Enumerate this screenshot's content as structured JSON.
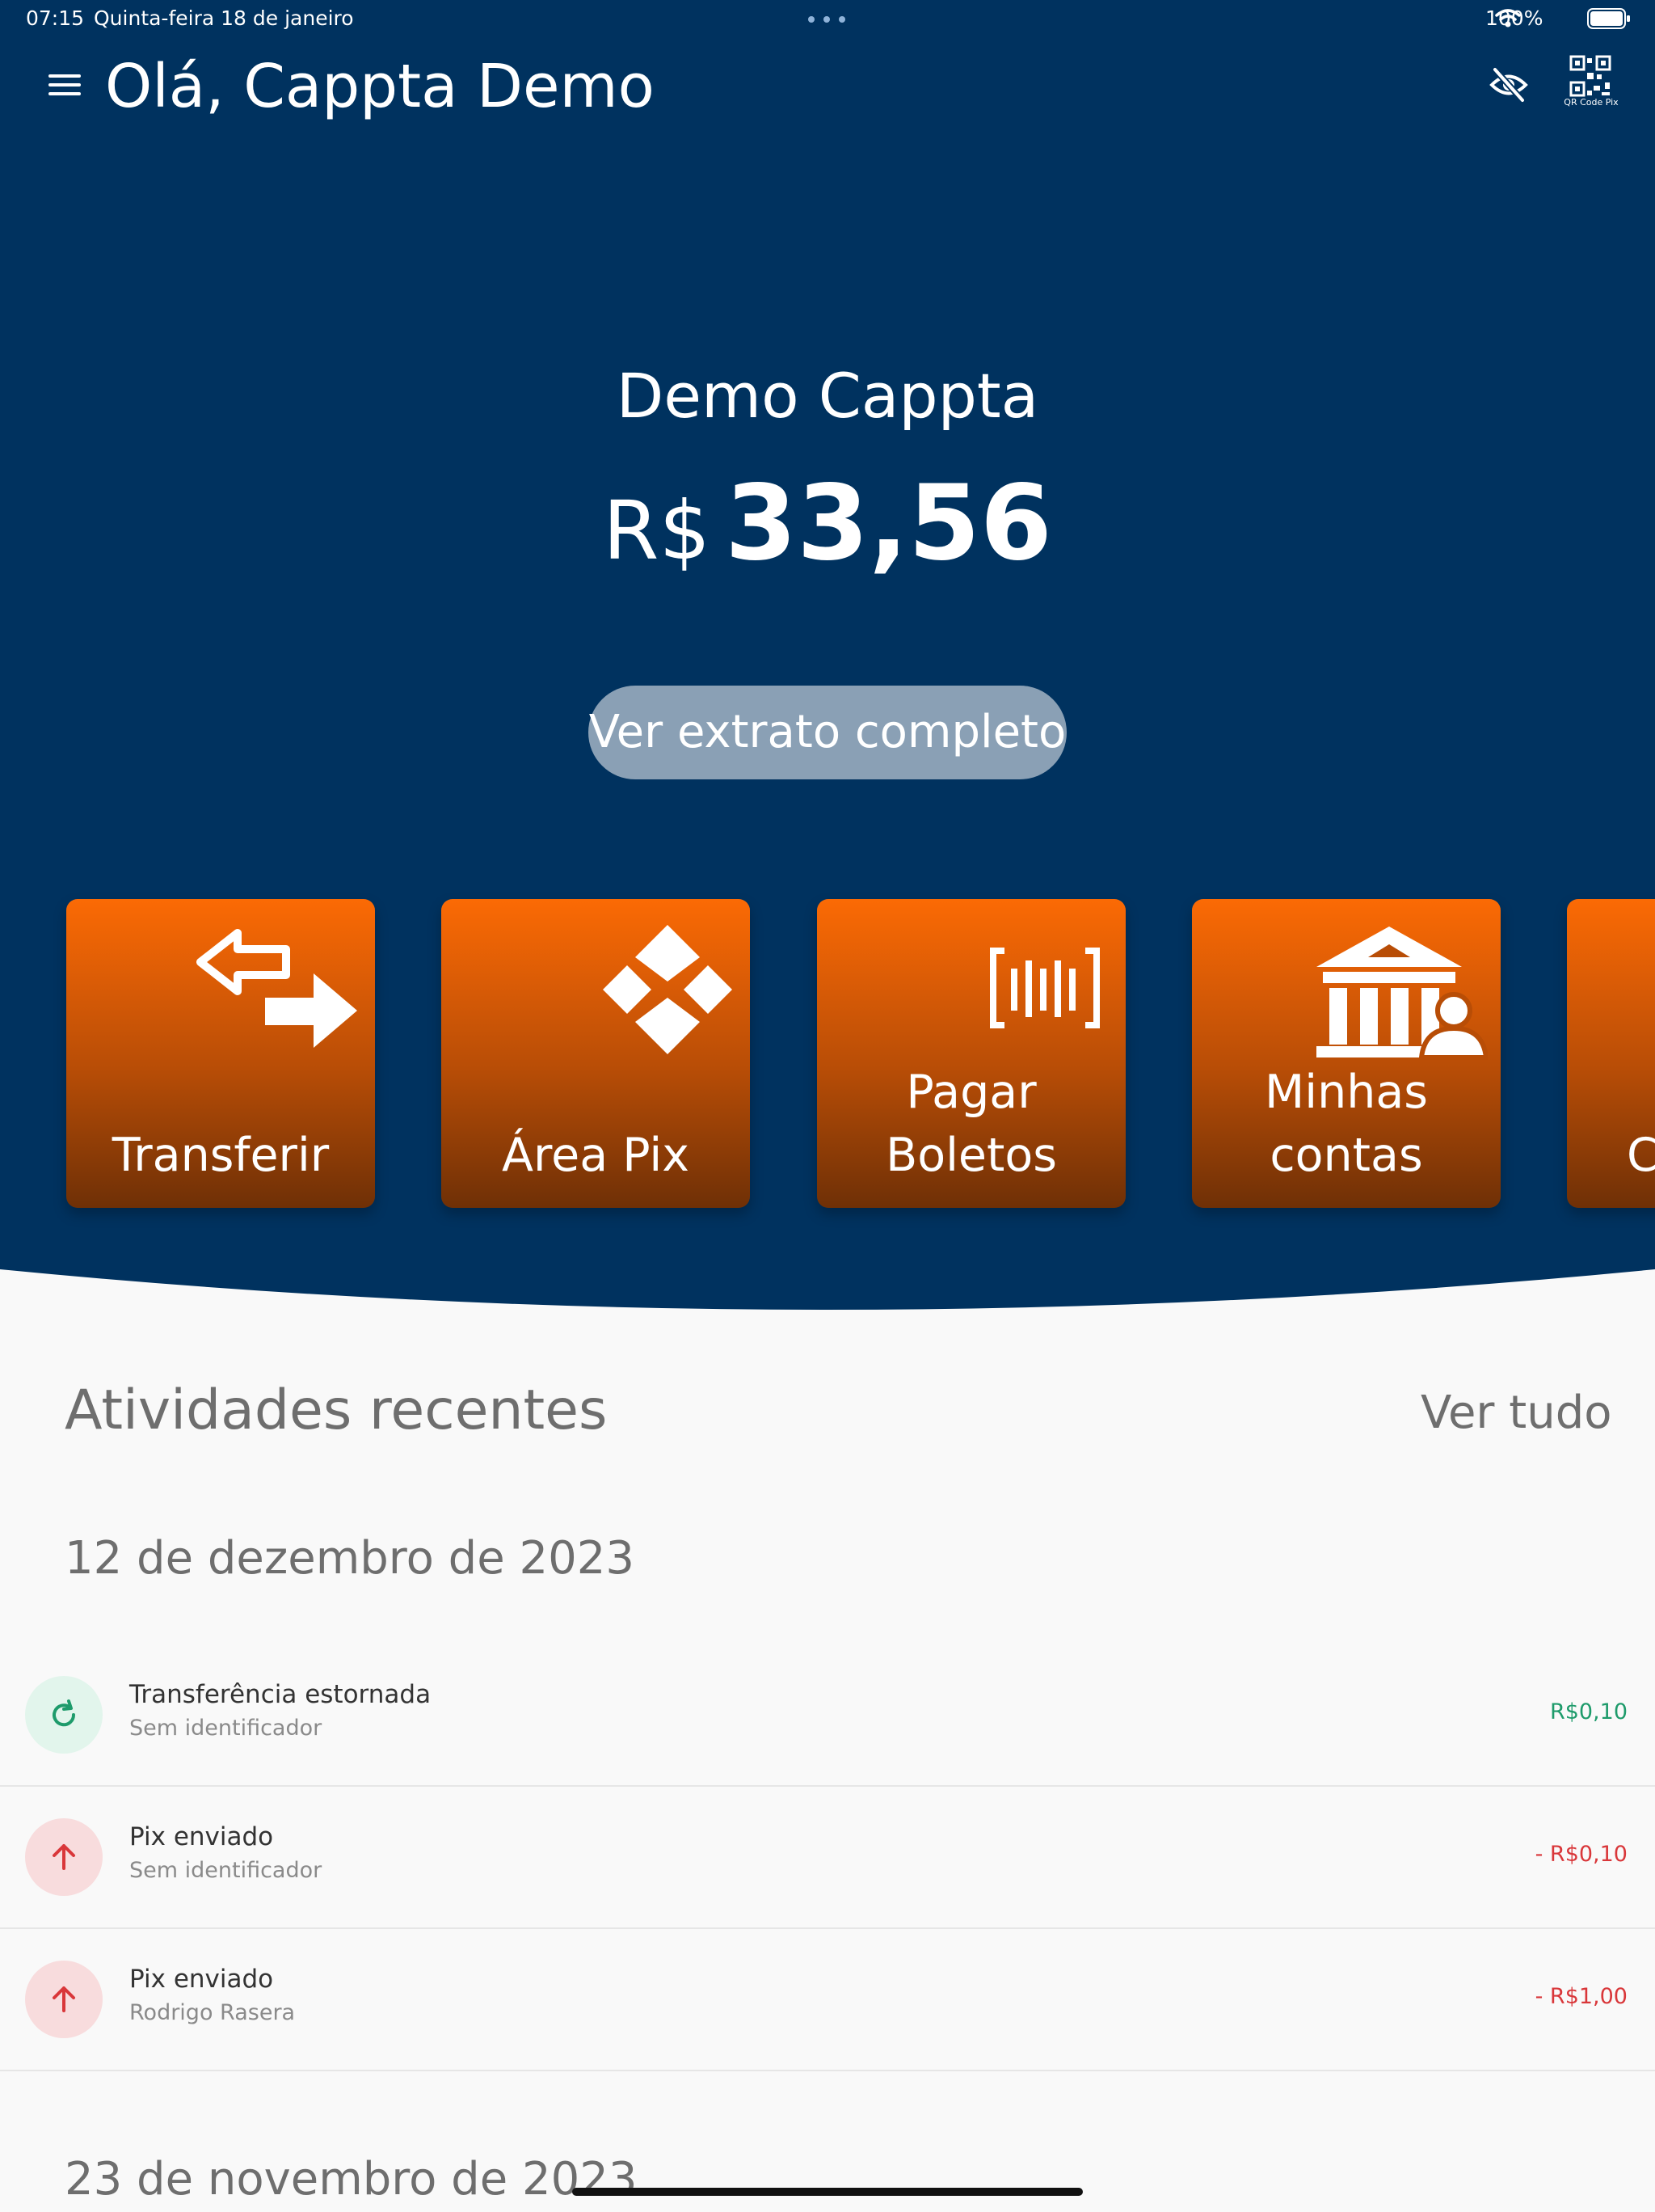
{
  "status_bar": {
    "time": "07:15",
    "date": "Quinta-feira 18 de janeiro",
    "battery": "100%"
  },
  "header": {
    "greeting": "Olá, Cappta Demo",
    "qr_label": "QR Code Pix",
    "icons": [
      "menu-icon",
      "eye-off-icon",
      "qr-code-icon"
    ]
  },
  "balance": {
    "account_name": "Demo Cappta",
    "currency": "R$",
    "amount": "33,56",
    "statement_button": "Ver extrato completo"
  },
  "actions": [
    {
      "label": "Transferir",
      "icon": "transfer-arrows-icon"
    },
    {
      "label": "Área Pix",
      "icon": "pix-icon"
    },
    {
      "label": "Pagar Boletos",
      "icon": "barcode-icon"
    },
    {
      "label": "Minhas contas",
      "icon": "bank-user-icon"
    },
    {
      "label": "C"
    }
  ],
  "recent": {
    "title": "Atividades recentes",
    "view_all": "Ver tudo",
    "groups": [
      {
        "date": "12 de dezembro de 2023",
        "items": [
          {
            "title": "Transferência estornada",
            "subtitle": "Sem identificador",
            "amount": "R$0,10",
            "kind": "refund"
          },
          {
            "title": "Pix enviado",
            "subtitle": "Sem identificador",
            "amount": "- R$0,10",
            "kind": "sent"
          },
          {
            "title": "Pix enviado",
            "subtitle": "Rodrigo Rasera",
            "amount": "- R$1,00",
            "kind": "sent"
          }
        ]
      },
      {
        "date": "23 de novembro de 2023"
      }
    ]
  },
  "colors": {
    "hero_bg": "#00325f",
    "card_orange": "#fb6a05",
    "positive": "#1e9b6b",
    "negative": "#d9373a",
    "positive_bg": "#e2f5ec",
    "negative_bg": "#f8dcdd",
    "button_bg": "#8aa0b5"
  }
}
